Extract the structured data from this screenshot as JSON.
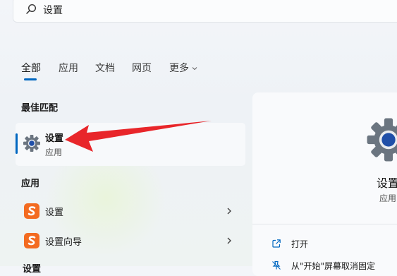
{
  "search": {
    "query": "设置"
  },
  "tabs": [
    {
      "label": "全部",
      "active": true
    },
    {
      "label": "应用"
    },
    {
      "label": "文档"
    },
    {
      "label": "网页"
    },
    {
      "label": "更多"
    }
  ],
  "best_match": {
    "section_label": "最佳匹配",
    "title": "设置",
    "subtitle": "应用"
  },
  "apps": {
    "section_label": "应用",
    "items": [
      {
        "label": "设置",
        "icon": "sogou-icon"
      },
      {
        "label": "设置向导",
        "icon": "sogou-icon"
      }
    ]
  },
  "next_section_label": "设置",
  "detail": {
    "title": "设置",
    "subtitle": "应用",
    "actions": [
      {
        "label": "打开",
        "icon": "open-external-icon"
      },
      {
        "label": "从\"开始\"屏幕取消固定",
        "icon": "unpin-icon"
      }
    ]
  },
  "colors": {
    "accent": "#0067c0",
    "annotation_arrow": "#e8262a",
    "sogou": "#f36b21"
  }
}
